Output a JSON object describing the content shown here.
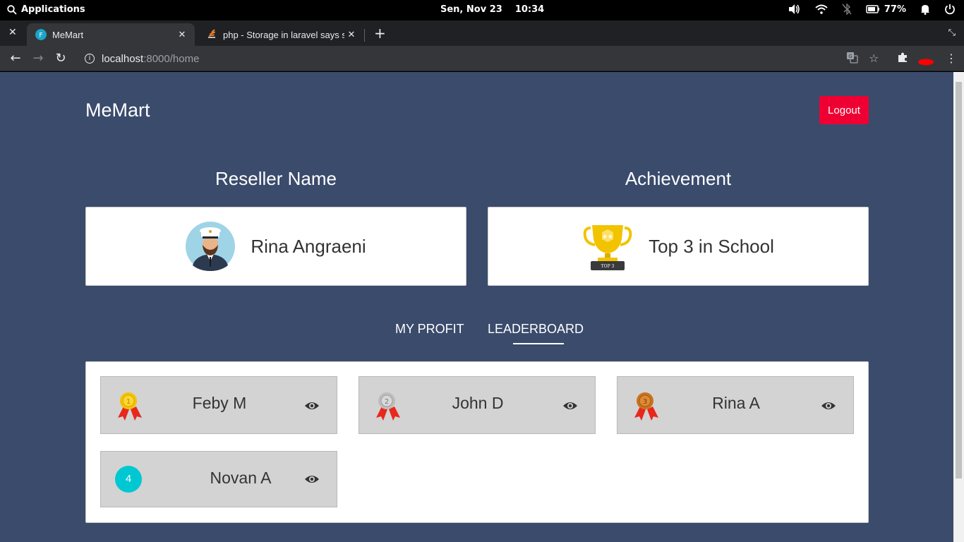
{
  "system_bar": {
    "apps_label": "Applications",
    "date": "Sen, Nov 23",
    "time": "10:34",
    "battery": "77%"
  },
  "browser": {
    "tabs": [
      {
        "title": "MeMart",
        "active": true
      },
      {
        "title": "php - Storage in laravel says sy",
        "active": false
      }
    ],
    "url_host": "localhost",
    "url_path": ":8000/home"
  },
  "page": {
    "brand": "MeMart",
    "logout_label": "Logout",
    "reseller_heading": "Reseller Name",
    "achievement_heading": "Achievement",
    "reseller_name": "Rina Angraeni",
    "achievement_text": "Top 3 in School",
    "trophy_label": "TOP 3",
    "tabs": [
      {
        "label": "MY PROFIT",
        "active": false
      },
      {
        "label": "LEADERBOARD",
        "active": true
      }
    ],
    "leaderboard": [
      {
        "rank": "1",
        "name": "Feby M",
        "medal": "gold-medal-icon"
      },
      {
        "rank": "2",
        "name": "John D",
        "medal": "silver-medal-icon"
      },
      {
        "rank": "3",
        "name": "Rina A",
        "medal": "bronze-medal-icon"
      },
      {
        "rank": "4",
        "name": "Novan A",
        "medal": "rank-circle"
      }
    ]
  },
  "colors": {
    "page_bg": "#3a4b6c",
    "logout_bg": "#ee0033",
    "rank4_badge": "#00c8d2",
    "gold": "#f2c300",
    "silver": "#c0c0c0",
    "bronze": "#cd7f32"
  }
}
